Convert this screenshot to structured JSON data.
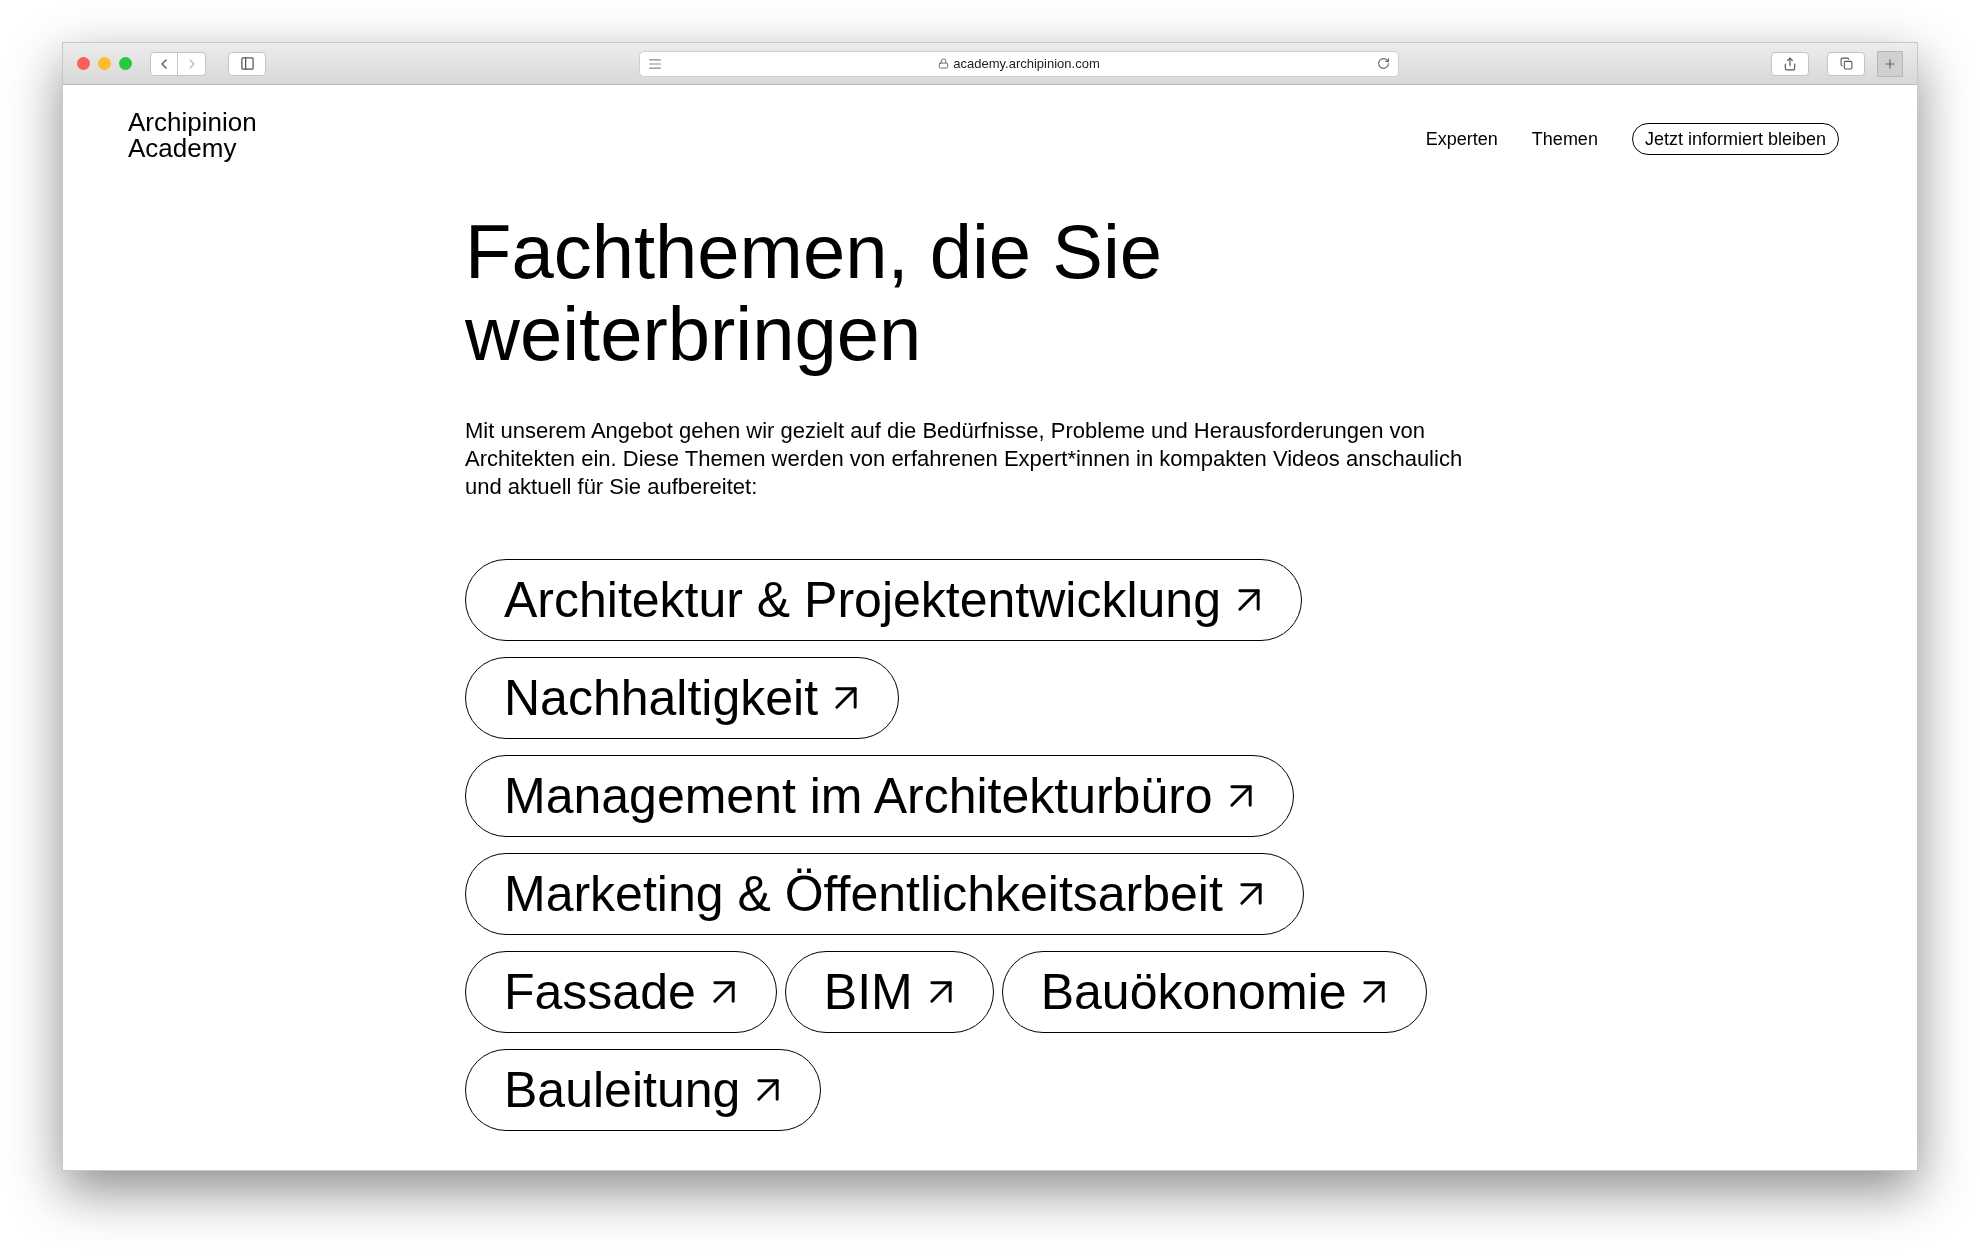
{
  "browser": {
    "url": "academy.archipinion.com"
  },
  "header": {
    "logo": [
      "Archipinion",
      "Academy"
    ],
    "nav": [
      {
        "label": "Experten",
        "kind": "link"
      },
      {
        "label": "Themen",
        "kind": "link"
      },
      {
        "label": "Jetzt informiert bleiben",
        "kind": "button"
      }
    ]
  },
  "heading": "Fachthemen, die Sie weiterbringen",
  "intro": "Mit unserem Angebot gehen wir gezielt auf die Bedürfnisse, Probleme und Herausforderungen von Architekten ein. Diese Themen werden von erfahrenen Expert*innen in kompakten Videos anschaulich und aktuell für Sie aufbereitet:",
  "topics": [
    "Architektur & Projektentwicklung",
    "Nachhaltigkeit",
    "Management im Architekturbüro",
    "Marketing & Öffentlichkeitsarbeit",
    "Fassade",
    "BIM",
    "Bauökonomie",
    "Bauleitung"
  ]
}
